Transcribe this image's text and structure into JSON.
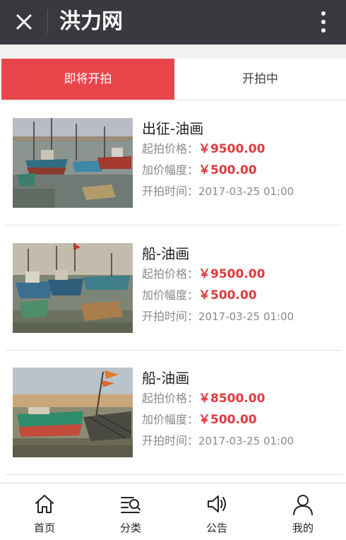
{
  "header": {
    "title": "洪力网",
    "close_icon": "close-icon",
    "more_icon": "more-vertical-icon"
  },
  "tabs": [
    {
      "label": "即将开拍",
      "active": true
    },
    {
      "label": "开拍中",
      "active": false
    }
  ],
  "colors": {
    "accent": "#e8454b",
    "price": "#e0393f",
    "titlebar": "#393a3f"
  },
  "items": [
    {
      "name": "出征-油画",
      "start_price_label": "起拍价格：",
      "start_price": "￥9500.00",
      "increment_label": "加价幅度：",
      "increment": "￥500.00",
      "start_time_label": "开拍时间：",
      "start_time": "2017-03-25 01:00"
    },
    {
      "name": "船-油画",
      "start_price_label": "起拍价格：",
      "start_price": "￥9500.00",
      "increment_label": "加价幅度：",
      "increment": "￥500.00",
      "start_time_label": "开拍时间：",
      "start_time": "2017-03-25 01:00"
    },
    {
      "name": "船-油画",
      "start_price_label": "起拍价格：",
      "start_price": "￥8500.00",
      "increment_label": "加价幅度：",
      "increment": "￥500.00",
      "start_time_label": "开拍时间：",
      "start_time": "2017-03-25 01:00"
    }
  ],
  "nav": [
    {
      "label": "首页",
      "icon": "home-icon"
    },
    {
      "label": "分类",
      "icon": "category-search-icon"
    },
    {
      "label": "公告",
      "icon": "speaker-icon"
    },
    {
      "label": "我的",
      "icon": "user-icon"
    }
  ]
}
